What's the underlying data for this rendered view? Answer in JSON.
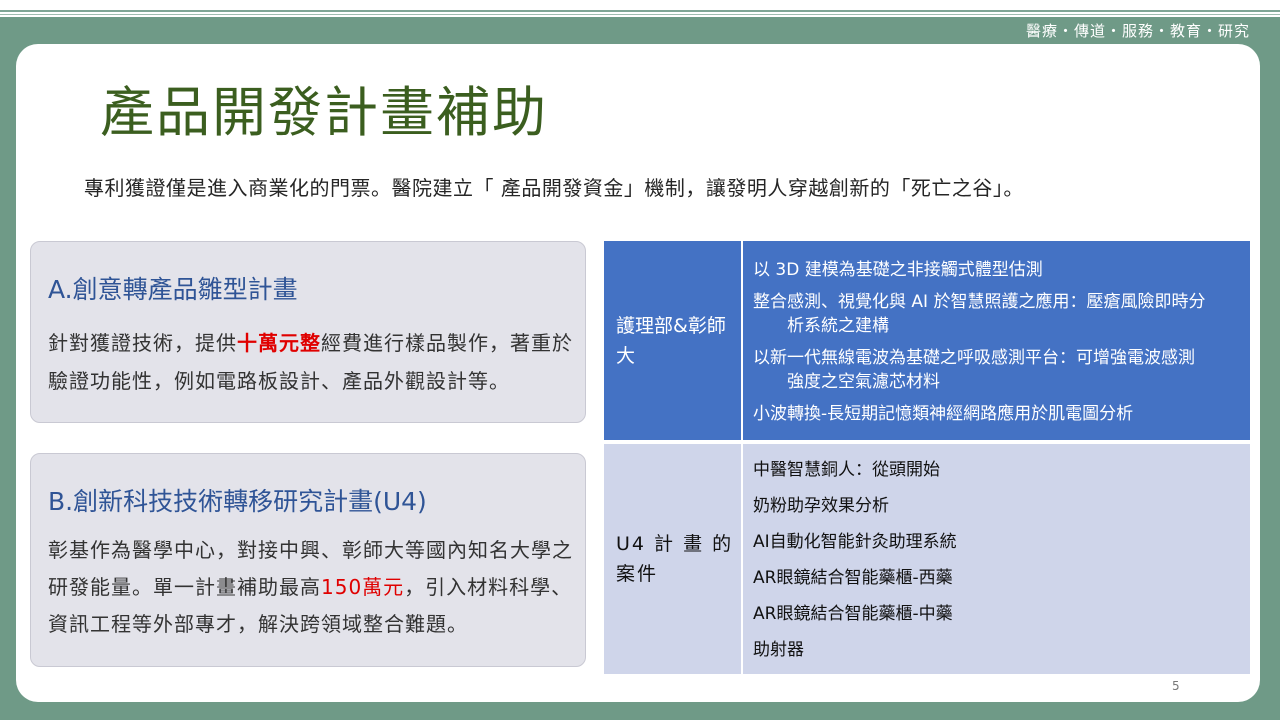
{
  "header": {
    "tagline": "醫療・傳道・服務・教育・研究"
  },
  "slide": {
    "title": "產品開發計畫補助",
    "subtitle": "專利獲證僅是進入商業化的門票。醫院建立「 產品開發資金」機制，讓發明人穿越創新的「死亡之谷」。",
    "page_number": "5"
  },
  "box_a": {
    "title": "A.創意轉產品雛型計畫",
    "body_before": "針對獲證技術，提供",
    "body_highlight": "十萬元整",
    "body_after": "經費進行樣品製作，著重於驗證功能性，例如電路板設計、產品外觀設計等。"
  },
  "box_b": {
    "title": "B.創新科技技術轉移研究計畫(U4)",
    "body_before": "彰基作為醫學中心，對接中興、彰師大等國內知名大學之研發能量。單一計畫補助最高",
    "body_highlight": "150萬元",
    "body_after": "，引入材料科學、資訊工程等外部專才，解決跨領域整合難題。"
  },
  "table": {
    "rows": [
      {
        "label": "護理部&彰師大",
        "items": [
          "以 3D 建模為基礎之非接觸式體型估測",
          "整合感測、視覺化與 AI 於智慧照護之應用：壓瘡風險即時分",
          "析系統之建構",
          "以新一代無線電波為基礎之呼吸感測平台：可增強電波感測",
          "強度之空氣濾芯材料",
          "小波轉換-長短期記憶類神經網路應用於肌電圖分析"
        ]
      },
      {
        "label": "U4 計 畫 的 案件",
        "items": [
          "中醫智慧銅人：從頭開始",
          "奶粉助孕效果分析",
          "AI自動化智能針灸助理系統",
          "AR眼鏡結合智能藥櫃-西藥",
          "AR眼鏡結合智能藥櫃-中藥",
          "助射器"
        ]
      }
    ]
  },
  "colors": {
    "frame": "#6f9a87",
    "title": "#3b5e1f",
    "box_title": "#2f5496",
    "highlight": "#e00000",
    "row1_bg": "#4472c4",
    "row2_bg": "#cfd5ea"
  }
}
